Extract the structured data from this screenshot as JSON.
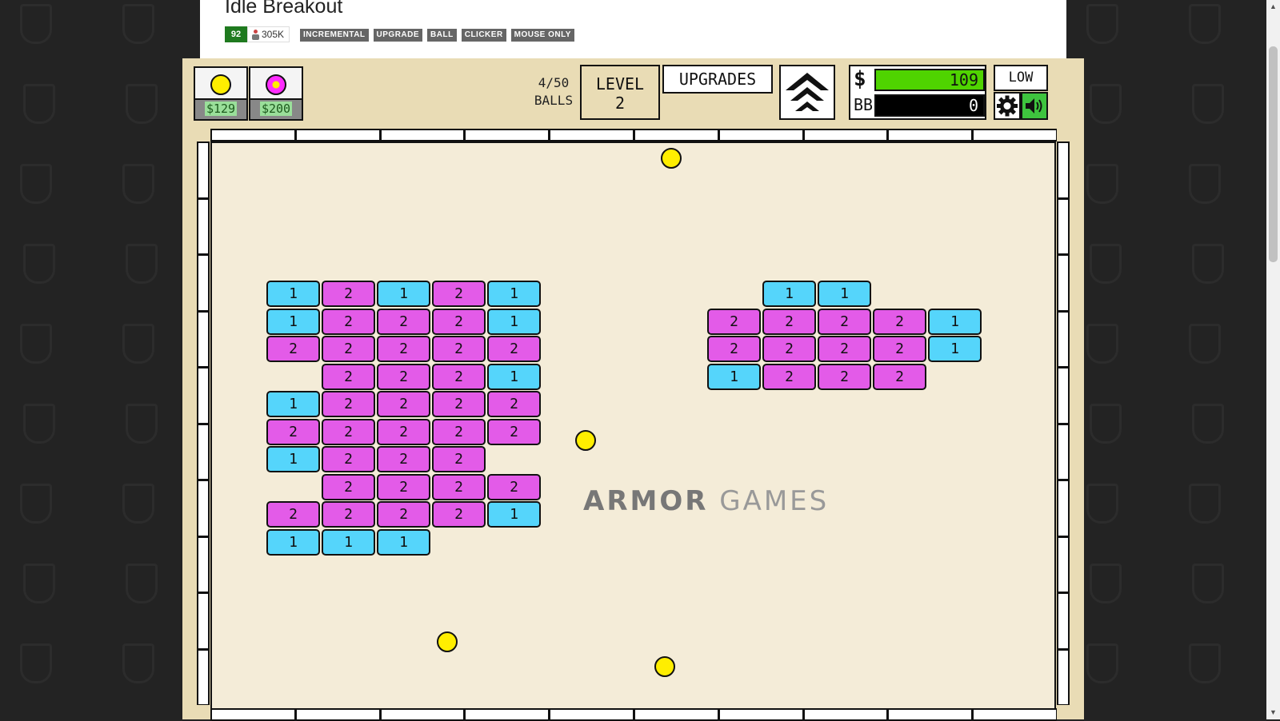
{
  "page": {
    "title": "Idle Breakout",
    "rating": "92",
    "plays": "305K",
    "tags": [
      "INCREMENTAL",
      "UPGRADE",
      "BALL",
      "CLICKER",
      "MOUSE ONLY"
    ]
  },
  "game": {
    "shop": [
      {
        "name": "yellow-ball",
        "price": "$129",
        "color": "#ffee00"
      },
      {
        "name": "pink-ball",
        "price": "$200",
        "color": "#ff2cff"
      }
    ],
    "balls_count": "4/50",
    "balls_label": "BALLS",
    "level_label": "LEVEL",
    "level_value": "2",
    "upgrades_label": "UPGRADES",
    "money_symbol": "$",
    "money": "109",
    "bb_label": "BB",
    "bb_value": "0",
    "quality": "LOW",
    "watermark_strong": "ARMOR",
    "watermark_light": "GAMES",
    "colors": {
      "hp1": "#55d5fb",
      "hp2": "#e35be8",
      "ball": "#ffee00",
      "cash": "#4fd400"
    },
    "left_grid": [
      [
        1,
        2,
        1,
        2,
        1
      ],
      [
        1,
        2,
        2,
        2,
        1
      ],
      [
        2,
        2,
        2,
        2,
        2
      ],
      [
        0,
        2,
        2,
        2,
        1
      ],
      [
        1,
        2,
        2,
        2,
        2
      ],
      [
        2,
        2,
        2,
        2,
        2
      ],
      [
        1,
        2,
        2,
        2,
        0
      ],
      [
        0,
        2,
        2,
        2,
        2
      ],
      [
        2,
        2,
        2,
        2,
        1
      ],
      [
        1,
        1,
        1,
        0,
        0
      ]
    ],
    "right_grid": [
      [
        0,
        1,
        1,
        0,
        0
      ],
      [
        2,
        2,
        2,
        2,
        1
      ],
      [
        2,
        2,
        2,
        2,
        1
      ],
      [
        1,
        2,
        2,
        2,
        0
      ]
    ]
  }
}
